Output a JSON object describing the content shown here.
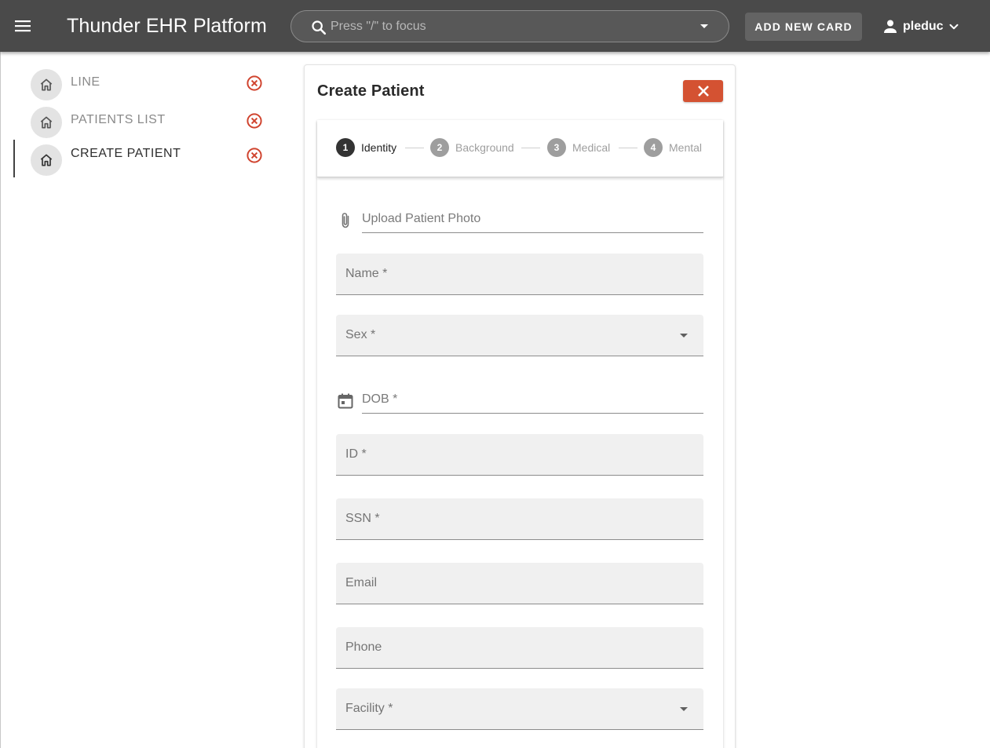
{
  "app": {
    "title": "Thunder EHR Platform",
    "accent_color": "#d45232",
    "appbar_color": "#4a4a4a"
  },
  "search": {
    "placeholder": "Press \"/\" to focus",
    "value": ""
  },
  "toolbar": {
    "add_card_label": "ADD NEW CARD",
    "user_name": "pleduc"
  },
  "sidebar": {
    "items": [
      {
        "label": "LINE",
        "icon": "home-icon",
        "active": false
      },
      {
        "label": "PATIENTS LIST",
        "icon": "home-icon",
        "active": false
      },
      {
        "label": "CREATE PATIENT",
        "icon": "home-icon",
        "active": true
      }
    ]
  },
  "card": {
    "title": "Create Patient",
    "close_icon": "close-icon"
  },
  "stepper": {
    "steps": [
      {
        "number": "1",
        "label": "Identity",
        "active": true
      },
      {
        "number": "2",
        "label": "Background",
        "active": false
      },
      {
        "number": "3",
        "label": "Medical",
        "active": false
      },
      {
        "number": "4",
        "label": "Mental",
        "active": false
      }
    ]
  },
  "form": {
    "upload_label": "Upload Patient Photo",
    "name_label": "Name *",
    "sex_label": "Sex *",
    "dob_label": "DOB *",
    "id_label": "ID *",
    "ssn_label": "SSN *",
    "email_label": "Email",
    "phone_label": "Phone",
    "facility_label": "Facility *"
  }
}
